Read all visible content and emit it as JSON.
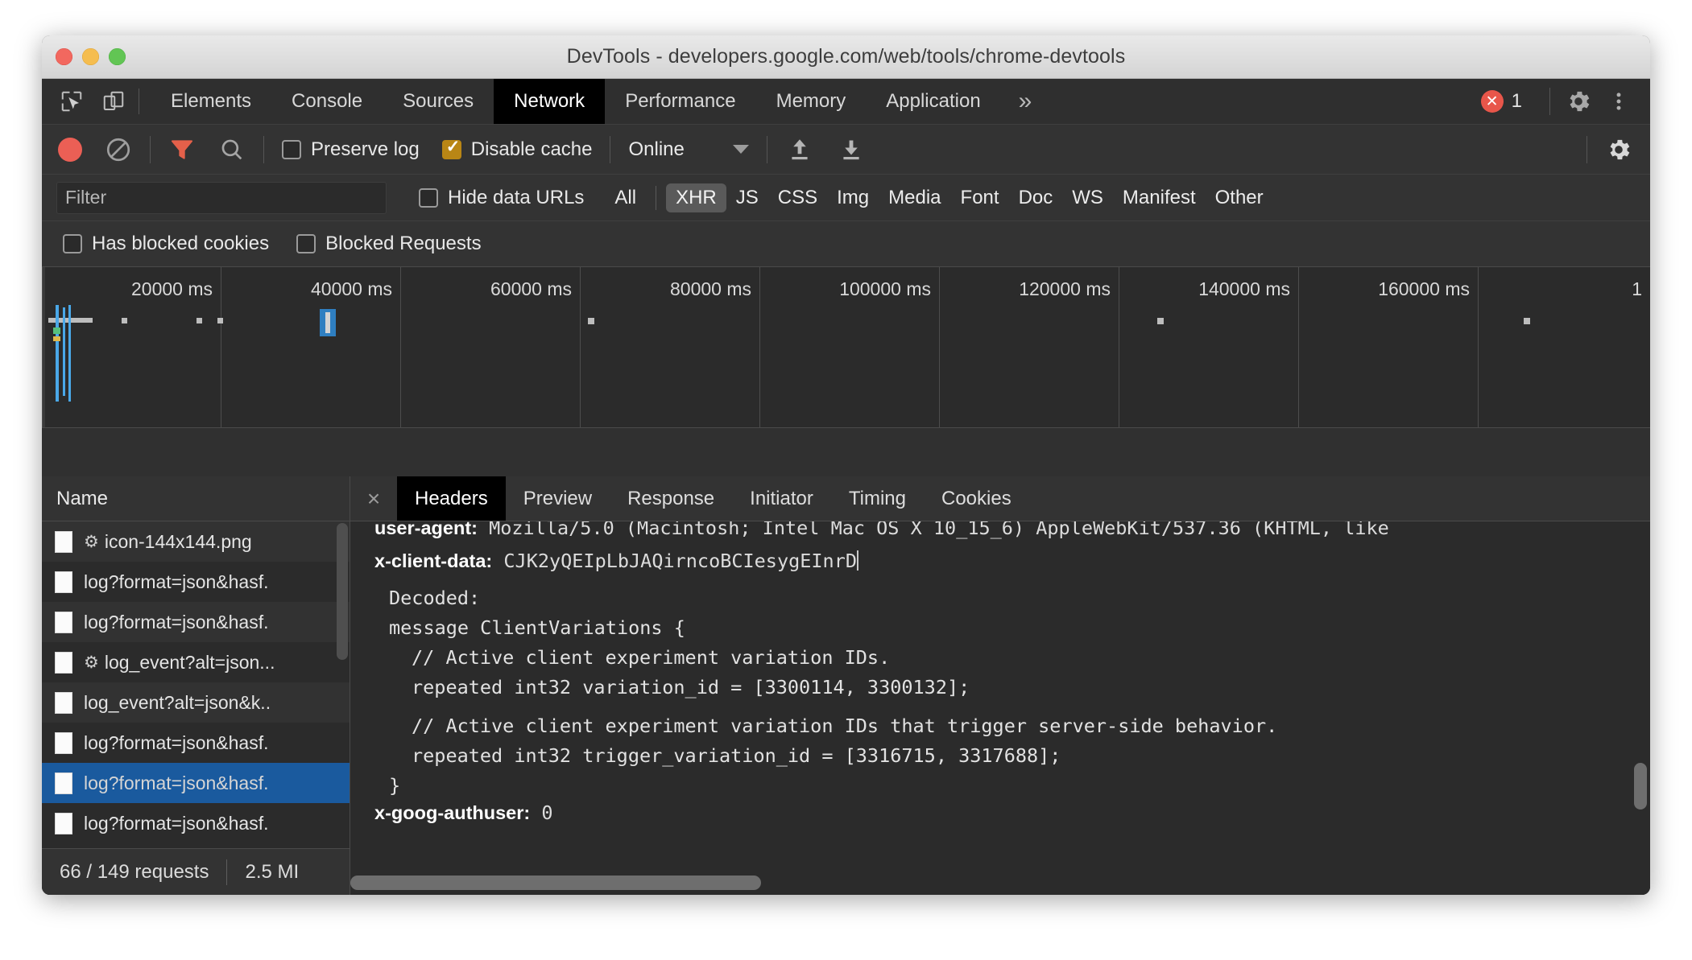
{
  "window": {
    "title": "DevTools - developers.google.com/web/tools/chrome-devtools"
  },
  "main_tabs": {
    "items": [
      {
        "label": "Elements",
        "active": false
      },
      {
        "label": "Console",
        "active": false
      },
      {
        "label": "Sources",
        "active": false
      },
      {
        "label": "Network",
        "active": true
      },
      {
        "label": "Performance",
        "active": false
      },
      {
        "label": "Memory",
        "active": false
      },
      {
        "label": "Application",
        "active": false
      }
    ],
    "more_label": "»",
    "error_count": "1",
    "inspect_icon": "inspect-element-icon",
    "device_icon": "device-toolbar-icon",
    "settings_icon": "gear-icon",
    "menu_icon": "kebab-menu-icon"
  },
  "network_toolbar": {
    "record_icon": "record-button-icon",
    "clear_icon": "clear-icon",
    "filter_icon": "filter-icon",
    "search_icon": "search-icon",
    "preserve_log_label": "Preserve log",
    "preserve_log_checked": false,
    "disable_cache_label": "Disable cache",
    "disable_cache_checked": true,
    "throttling_value": "Online",
    "import_icon": "upload-arrow-icon",
    "export_icon": "download-arrow-icon",
    "settings_icon": "gear-icon"
  },
  "filter_row": {
    "filter_placeholder": "Filter",
    "filter_value": "",
    "hide_data_urls_label": "Hide data URLs",
    "hide_data_urls_checked": false,
    "types": [
      {
        "label": "All",
        "active": false
      },
      {
        "label": "XHR",
        "active": true
      },
      {
        "label": "JS",
        "active": false
      },
      {
        "label": "CSS",
        "active": false
      },
      {
        "label": "Img",
        "active": false
      },
      {
        "label": "Media",
        "active": false
      },
      {
        "label": "Font",
        "active": false
      },
      {
        "label": "Doc",
        "active": false
      },
      {
        "label": "WS",
        "active": false
      },
      {
        "label": "Manifest",
        "active": false
      },
      {
        "label": "Other",
        "active": false
      }
    ]
  },
  "blocked_row": {
    "has_blocked_cookies_label": "Has blocked cookies",
    "has_blocked_cookies_checked": false,
    "blocked_requests_label": "Blocked Requests",
    "blocked_requests_checked": false
  },
  "overview": {
    "tick_labels": [
      "20000 ms",
      "40000 ms",
      "60000 ms",
      "80000 ms",
      "100000 ms",
      "120000 ms",
      "140000 ms",
      "160000 ms",
      "1"
    ]
  },
  "request_list": {
    "column_header": "Name",
    "rows": [
      {
        "name": "icon-144x144.png",
        "has_gear": true,
        "selected": false
      },
      {
        "name": "log?format=json&hasf.",
        "has_gear": false,
        "selected": false
      },
      {
        "name": "log?format=json&hasf.",
        "has_gear": false,
        "selected": false
      },
      {
        "name": "log_event?alt=json...",
        "has_gear": true,
        "selected": false
      },
      {
        "name": "log_event?alt=json&k..",
        "has_gear": false,
        "selected": false
      },
      {
        "name": "log?format=json&hasf.",
        "has_gear": false,
        "selected": false
      },
      {
        "name": "log?format=json&hasf.",
        "has_gear": false,
        "selected": true
      },
      {
        "name": "log?format=json&hasf.",
        "has_gear": false,
        "selected": false
      }
    ],
    "status_requests": "66 / 149 requests",
    "status_transferred": "2.5 MI"
  },
  "detail_tabs": {
    "close_label": "×",
    "items": [
      {
        "label": "Headers",
        "active": true
      },
      {
        "label": "Preview",
        "active": false
      },
      {
        "label": "Response",
        "active": false
      },
      {
        "label": "Initiator",
        "active": false
      },
      {
        "label": "Timing",
        "active": false
      },
      {
        "label": "Cookies",
        "active": false
      }
    ]
  },
  "headers_content": {
    "user_agent_name": "user-agent:",
    "user_agent_value": " Mozilla/5.0 (Macintosh; Intel Mac OS X 10_15_6) AppleWebKit/537.36 (KHTML, like",
    "x_client_data_name": "x-client-data:",
    "x_client_data_value": " CJK2yQEIpLbJAQirncoBCIesygEInrD",
    "decoded_label": "Decoded:",
    "message_open": "message ClientVariations {",
    "comment_1": "// Active client experiment variation IDs.",
    "variation_ids": "repeated int32 variation_id = [3300114, 3300132];",
    "comment_2": "// Active client experiment variation IDs that trigger server-side behavior.",
    "trigger_variation_ids": "repeated int32 trigger_variation_id = [3316715, 3317688];",
    "message_close": "}",
    "goog_authuser_name": "x-goog-authuser:",
    "goog_authuser_value": " 0"
  }
}
